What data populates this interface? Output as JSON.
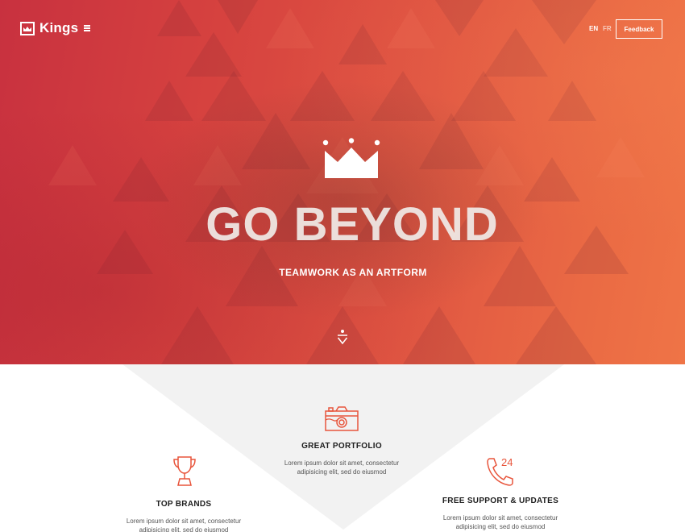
{
  "brand": {
    "name": "Kings",
    "logo_icon": "crown-box-icon"
  },
  "nav": {
    "menu_icon": "hamburger-icon",
    "languages": [
      {
        "code": "EN",
        "active": true
      },
      {
        "code": "FR",
        "active": false
      }
    ],
    "feedback_label": "Feedback"
  },
  "hero": {
    "icon": "crown-icon",
    "title": "GO BEYOND",
    "subtitle": "TEAMWORK AS AN ARTFORM",
    "scroll_icon": "scroll-down-icon"
  },
  "colors": {
    "accent": "#e05542",
    "hero_start": "#c8313f",
    "hero_end": "#ef7446",
    "feature_icon": "#e8553c"
  },
  "features": [
    {
      "icon": "camera-icon",
      "title": "GREAT PORTFOLIO",
      "text_line1": "Lorem ipsum dolor sit amet, consectetur",
      "text_line2": "adipisicing elit, sed do eiusmod"
    },
    {
      "icon": "trophy-icon",
      "title": "TOP BRANDS",
      "text_line1": "Lorem ipsum dolor sit amet, consectetur",
      "text_line2": "adipisicing elit, sed do eiusmod"
    },
    {
      "icon": "phone-24-icon",
      "title": "FREE SUPPORT & UPDATES",
      "text_line1": "Lorem ipsum dolor sit amet, consectetur",
      "text_line2": "adipisicing elit, sed do eiusmod",
      "badge": "24"
    }
  ]
}
